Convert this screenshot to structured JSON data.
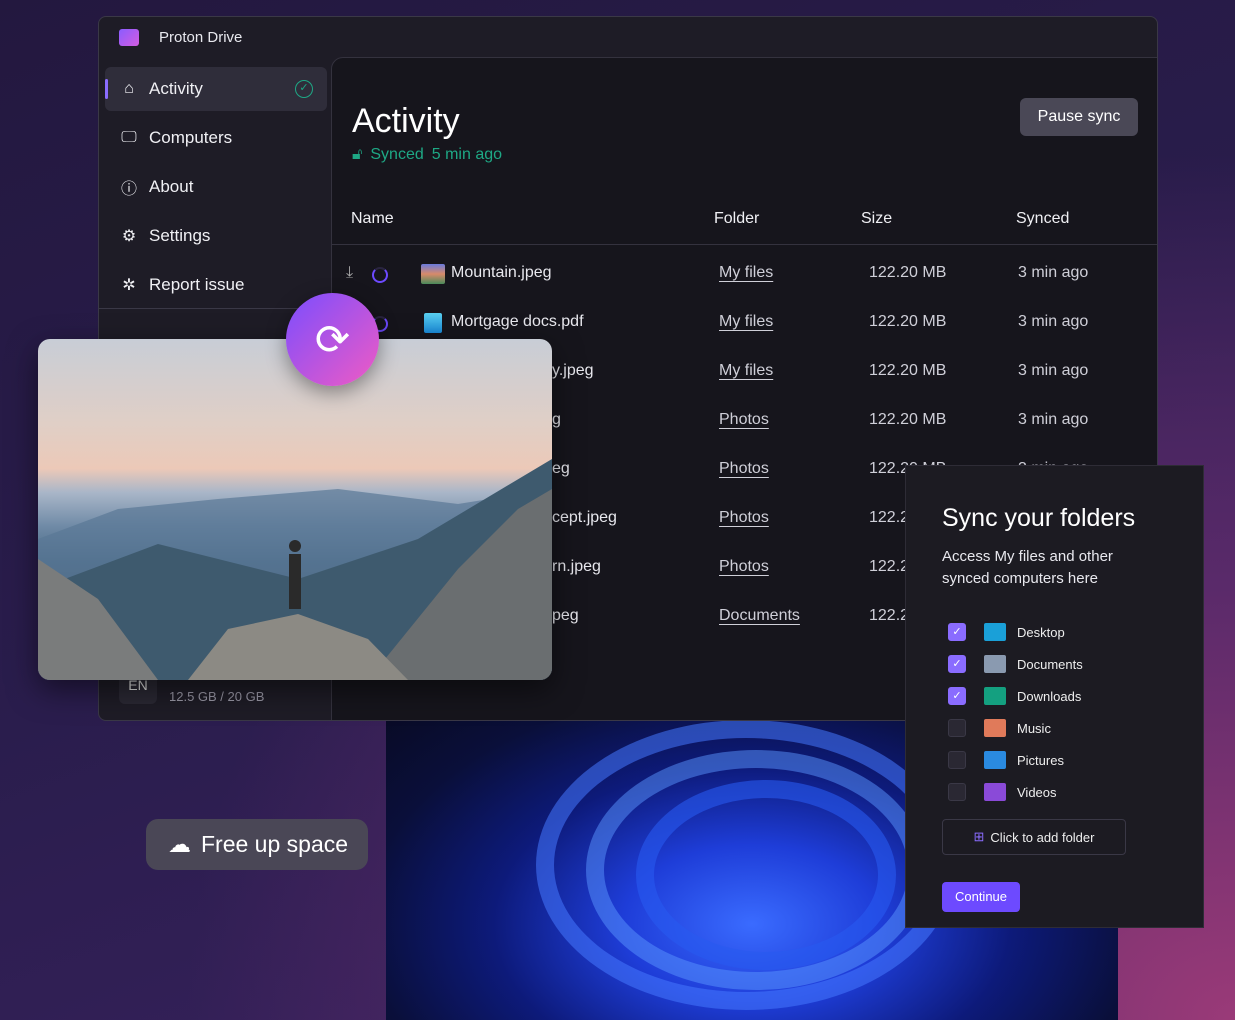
{
  "app": {
    "title": "Proton Drive"
  },
  "sidebar": {
    "items": [
      {
        "label": "Activity",
        "icon": "home-icon",
        "active": true
      },
      {
        "label": "Computers",
        "icon": "monitor-icon"
      },
      {
        "label": "About",
        "icon": "info-icon"
      },
      {
        "label": "Settings",
        "icon": "gear-icon"
      },
      {
        "label": "Report issue",
        "icon": "bug-icon"
      }
    ],
    "language": "EN",
    "storage": "12.5 GB / 20 GB"
  },
  "main": {
    "title": "Activity",
    "status": "Synced",
    "last_sync": "5 min ago",
    "pause_label": "Pause sync",
    "columns": [
      "Name",
      "Folder",
      "Size",
      "Synced"
    ],
    "rows": [
      {
        "name": "Mountain.jpeg",
        "folder": "My files",
        "size": "122.20 MB",
        "synced": "3 min ago"
      },
      {
        "name": "Mortgage docs.pdf",
        "folder": "My files",
        "size": "122.20 MB",
        "synced": "3 min ago"
      },
      {
        "name": "y.jpeg",
        "folder": "My files",
        "size": "122.20 MB",
        "synced": "3 min ago"
      },
      {
        "name": "g",
        "folder": "Photos",
        "size": "122.20 MB",
        "synced": "3 min ago"
      },
      {
        "name": "eg",
        "folder": "Photos",
        "size": "122.20 MB",
        "synced": "3 min ago"
      },
      {
        "name": "cept.jpeg",
        "folder": "Photos",
        "size": "122.2",
        "synced": ""
      },
      {
        "name": "rn.jpeg",
        "folder": "Photos",
        "size": "122.2",
        "synced": ""
      },
      {
        "name": "peg",
        "folder": "Documents",
        "size": "122.2",
        "synced": ""
      }
    ]
  },
  "free_up": {
    "label": "Free up space"
  },
  "sync_panel": {
    "title": "Sync your folders",
    "description": "Access My files and other synced computers here",
    "folders": [
      {
        "label": "Desktop",
        "checked": true,
        "color": "#1aa0d8"
      },
      {
        "label": "Documents",
        "checked": true,
        "color": "#8a9ab0"
      },
      {
        "label": "Downloads",
        "checked": true,
        "color": "#14a080"
      },
      {
        "label": "Music",
        "checked": false,
        "color": "#e07a5a"
      },
      {
        "label": "Pictures",
        "checked": false,
        "color": "#2a8ae0"
      },
      {
        "label": "Videos",
        "checked": false,
        "color": "#8a4ad8"
      }
    ],
    "add_label": "Click to add folder",
    "continue_label": "Continue"
  }
}
